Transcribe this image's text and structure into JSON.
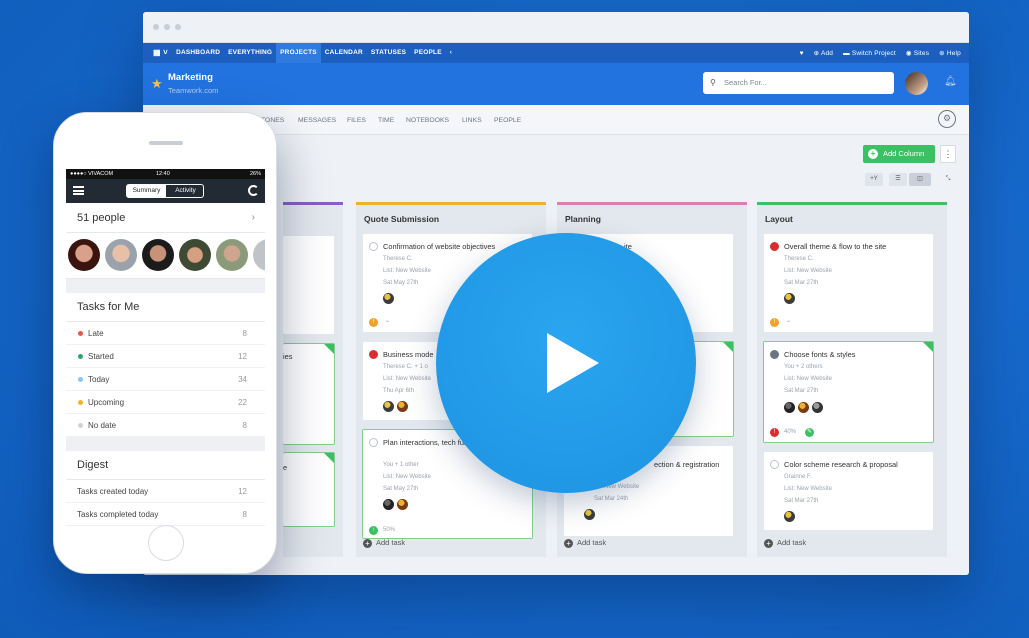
{
  "colors": {
    "brand": "#2273e0",
    "nav": "#1c5fbf",
    "accent_green": "#3cc063",
    "background": "#1669cc"
  },
  "nav": {
    "grid_icon": "grid-icon",
    "items": [
      "DASHBOARD",
      "EVERYTHING",
      "PROJECTS",
      "CALENDAR",
      "STATUSES",
      "PEOPLE"
    ],
    "active": "PROJECTS",
    "add": "Add",
    "switch": "Switch Project",
    "sites": "Sites",
    "help": "Help"
  },
  "project": {
    "name": "Marketing",
    "company": "Teamwork.com"
  },
  "search": {
    "placeholder": "Search For..."
  },
  "tabs": [
    "TONES",
    "MESSAGES",
    "FILES",
    "TIME",
    "NOTEBOOKS",
    "LINKS",
    "PEOPLE"
  ],
  "toolbar": {
    "add_column": "Add Column",
    "filter": "+Y"
  },
  "columns": [
    {
      "title": "Quote Submission",
      "color": "#f0b132",
      "cards": [
        {
          "title": "Confirmation of website objectives",
          "assignee": "Therese C.",
          "list": "List: New Website",
          "date": "Sat May 27th"
        },
        {
          "title": "Business mode",
          "assignee": "Therese C. + 1 o",
          "list": "List: New Website",
          "date": "Thu Apr 6th"
        },
        {
          "title": "Plan interactions, tech functionalities",
          "assignee": "You + 1 other",
          "list": "List: New Website",
          "date": "Sat May 27th",
          "progress": "50%"
        }
      ],
      "add_task": "Add task"
    },
    {
      "title": "Planning",
      "color": "#e27bb1",
      "cards": [
        {
          "title": "ite"
        },
        {
          "title": "ection & registration",
          "list": "New Website",
          "date": "Sat Mar 24th"
        }
      ],
      "add_task": "Add task"
    },
    {
      "title": "Layout",
      "color": "#3cc063",
      "cards": [
        {
          "title": "Overall theme & flow to the site",
          "assignee": "Therese C.",
          "list": "List: New Website",
          "date": "Sat Mar 27th"
        },
        {
          "title": "Choose fonts & styles",
          "assignee": "You + 2 others",
          "list": "List: New Website",
          "date": "Sat Mar 27th",
          "progress": "40%"
        },
        {
          "title": "Color scheme research & proposal",
          "assignee": "Grainne F.",
          "list": "List: New Website",
          "date": "Sat Mar 27th"
        }
      ],
      "add_task": "Add task"
    }
  ],
  "left_column_fragments": [
    "ies",
    "e"
  ],
  "phone": {
    "carrier": "●●●●○ VIVACOM",
    "time": "12:40",
    "battery": "26%",
    "seg_on": "Summary",
    "seg_off": "Activity",
    "people": "51 people",
    "tasks_title": "Tasks for Me",
    "tasks": [
      {
        "label": "Late",
        "count": "8",
        "color": "#e05a4f"
      },
      {
        "label": "Started",
        "count": "12",
        "color": "#2fa36b"
      },
      {
        "label": "Today",
        "count": "34",
        "color": "#8fc3f2"
      },
      {
        "label": "Upcoming",
        "count": "22",
        "color": "#f0b132"
      },
      {
        "label": "No date",
        "count": "8",
        "color": "#d0d4d9"
      }
    ],
    "digest_title": "Digest",
    "digest": [
      {
        "label": "Tasks created today",
        "count": "12"
      },
      {
        "label": "Tasks completed today",
        "count": "8"
      }
    ]
  }
}
